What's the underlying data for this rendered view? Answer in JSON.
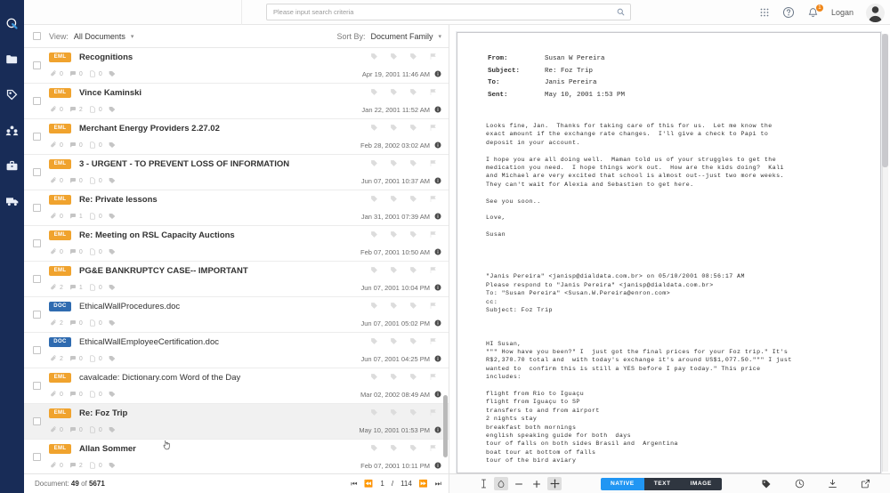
{
  "rail": {
    "items": [
      {
        "name": "logo-icon",
        "label": "Logo"
      },
      {
        "name": "folder-icon",
        "label": "Folders"
      },
      {
        "name": "tag-icon",
        "label": "Tags"
      },
      {
        "name": "group-icon",
        "label": "Groups"
      },
      {
        "name": "briefcase-icon",
        "label": "Cases"
      },
      {
        "name": "truck-icon",
        "label": "Productions"
      }
    ],
    "background": "#182c57"
  },
  "topbar": {
    "search": {
      "placeholder": "Please input search criteria",
      "value": ""
    },
    "user": "Logan",
    "notification_count": "1",
    "badge_color": "#f0871a"
  },
  "list": {
    "view_label": "View:",
    "view_value": "All Documents",
    "sort_label": "Sort By:",
    "sort_value": "Document Family",
    "footer": {
      "doc_label": "Document:",
      "doc_current": "49",
      "doc_of": "of",
      "doc_total": "5671",
      "page_current": "1",
      "page_sep": "/",
      "page_total": "114"
    },
    "rows": [
      {
        "type": "EML",
        "title": "Recognitions",
        "bold": true,
        "attachments": "0",
        "comments": "0",
        "pages": "0",
        "date": "Apr 19, 2001 11:46 AM",
        "selected": false
      },
      {
        "type": "EML",
        "title": "Vince Kaminski",
        "bold": true,
        "attachments": "0",
        "comments": "2",
        "pages": "0",
        "date": "Jan 22, 2001 11:52 AM",
        "selected": false
      },
      {
        "type": "EML",
        "title": "Merchant Energy Providers 2.27.02",
        "bold": true,
        "attachments": "0",
        "comments": "0",
        "pages": "0",
        "date": "Feb 28, 2002 03:02 AM",
        "selected": false
      },
      {
        "type": "EML",
        "title": "3 - URGENT - TO PREVENT LOSS OF INFORMATION",
        "bold": true,
        "attachments": "0",
        "comments": "0",
        "pages": "0",
        "date": "Jun 07, 2001 10:37 AM",
        "selected": false
      },
      {
        "type": "EML",
        "title": "Re: Private lessons",
        "bold": true,
        "attachments": "0",
        "comments": "1",
        "pages": "0",
        "date": "Jan 31, 2001 07:39 AM",
        "selected": false
      },
      {
        "type": "EML",
        "title": "Re: Meeting on RSL Capacity Auctions",
        "bold": true,
        "attachments": "0",
        "comments": "0",
        "pages": "0",
        "date": "Feb 07, 2001 10:50 AM",
        "selected": false
      },
      {
        "type": "EML",
        "title": "PG&E BANKRUPTCY CASE-- IMPORTANT",
        "bold": true,
        "attachments": "2",
        "comments": "1",
        "pages": "0",
        "date": "Jun 07, 2001 10:04 PM",
        "selected": false
      },
      {
        "type": "DOC",
        "title": "EthicalWallProcedures.doc",
        "bold": false,
        "attachments": "2",
        "comments": "0",
        "pages": "0",
        "date": "Jun 07, 2001 05:02 PM",
        "selected": false
      },
      {
        "type": "DOC",
        "title": "EthicalWallEmployeeCertification.doc",
        "bold": false,
        "attachments": "2",
        "comments": "0",
        "pages": "0",
        "date": "Jun 07, 2001 04:25 PM",
        "selected": false
      },
      {
        "type": "EML",
        "title": "cavalcade: Dictionary.com Word of the Day",
        "bold": false,
        "attachments": "0",
        "comments": "0",
        "pages": "0",
        "date": "Mar 02, 2002 08:49 AM",
        "selected": false
      },
      {
        "type": "EML",
        "title": "Re: Foz Trip",
        "bold": true,
        "attachments": "0",
        "comments": "0",
        "pages": "0",
        "date": "May 10, 2001 01:53 PM",
        "selected": true
      },
      {
        "type": "EML",
        "title": "Allan Sommer",
        "bold": true,
        "attachments": "0",
        "comments": "2",
        "pages": "0",
        "date": "Feb 07, 2001 10:11 PM",
        "selected": false
      }
    ]
  },
  "viewer": {
    "header": {
      "from_label": "From:",
      "from_value": "Susan W Pereira",
      "subject_label": "Subject:",
      "subject_value": "Re: Foz Trip",
      "to_label": "To:",
      "to_value": "Janis Pereira",
      "sent_label": "Sent:",
      "sent_value": "May 10, 2001 1:53 PM"
    },
    "body": "Looks fine, Jan.  Thanks for taking care of this for us.  Let me know the\nexact amount if the exchange rate changes.  I'll give a check to Papi to\ndeposit in your account.\n\nI hope you are all doing well.  Maman told us of your struggles to get the\nmedication you need.  I hope things work out.  How are the kids doing?  Kali\nand Michael are very excited that school is almost out--just two more weeks.\nThey can't wait for Alexia and Sebastien to get here.\n\nSee you soon..\n\nLove,\n\nSusan\n\n\n\n\n\"Janis Pereira\" <janisp@dialdata.com.br> on 05/10/2001 08:56:17 AM\nPlease respond to \"Janis Pereira\" <janisp@dialdata.com.br>\nTo: \"Susan Pereira\" <Susan.W.Pereira@enron.com>\ncc:\nSubject: Foz Trip\n\n\n\nHI Susan,\n\"\"\" How have you been?\" I  just got the final prices for your Foz trip.\" It's\nR$2,370.70 total and  with today's exchange it's around US$1,077.50.\"\"\" I just\nwanted to  confirm this is still a YES before I pay today.\" This price\nincludes:\n\nflight from Rio to Iguaçu\nflight from Iguaçu to SP\ntransfers to and from airport\n2 nights stay\nbreakfast both mornings\nenglish speaking guide for both  days\ntour of falls on both sides Brasil and  Argentina\nboat tour at bottom of falls\ntour of the bird aviary\n\nI'll wait to hear from  you.....Jan",
    "toolbar": {
      "modes": [
        {
          "label": "NATIVE",
          "active": true
        },
        {
          "label": "TEXT",
          "active": false
        },
        {
          "label": "IMAGE",
          "active": false
        }
      ],
      "active_color": "#2196f3",
      "tools": [
        "text-select-icon",
        "redact-icon",
        "zoom-out-icon",
        "zoom-in-icon",
        "pan-icon"
      ],
      "right_tools": [
        "tag-icon",
        "history-icon",
        "download-icon",
        "popout-icon"
      ]
    }
  }
}
